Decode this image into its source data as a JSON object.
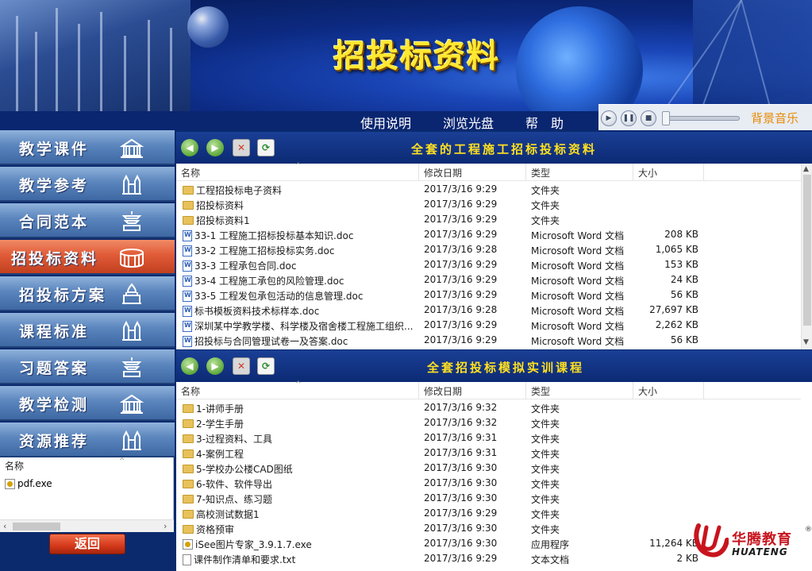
{
  "banner": {
    "title": "招投标资料"
  },
  "topnav": {
    "items": [
      {
        "label": "使用说明"
      },
      {
        "label": "浏览光盘"
      },
      {
        "label": "帮　助"
      }
    ]
  },
  "music": {
    "label": "背景音乐"
  },
  "sidebar": {
    "items": [
      {
        "label": "教学课件"
      },
      {
        "label": "教学参考"
      },
      {
        "label": "合同范本"
      },
      {
        "label": "招投标资料"
      },
      {
        "label": "招投标方案"
      },
      {
        "label": "课程标准"
      },
      {
        "label": "习题答案"
      },
      {
        "label": "教学检测"
      },
      {
        "label": "资源推荐"
      }
    ],
    "active_index": 3
  },
  "left_pane": {
    "header": "名称",
    "files": [
      {
        "name": "pdf.exe"
      }
    ]
  },
  "back_button": {
    "label": "返回"
  },
  "columns": {
    "name": "名称",
    "date": "修改日期",
    "type": "类型",
    "size": "大小"
  },
  "pane1": {
    "title": "全套的工程施工招标投标资料",
    "rows": [
      {
        "icon": "folder",
        "name": "工程招投标电子资料",
        "date": "2017/3/16 9:29",
        "type": "文件夹",
        "size": ""
      },
      {
        "icon": "folder",
        "name": "招投标资料",
        "date": "2017/3/16 9:29",
        "type": "文件夹",
        "size": ""
      },
      {
        "icon": "folder",
        "name": "招投标资料1",
        "date": "2017/3/16 9:29",
        "type": "文件夹",
        "size": ""
      },
      {
        "icon": "doc",
        "name": "33-1 工程施工招标投标基本知识.doc",
        "date": "2017/3/16 9:29",
        "type": "Microsoft Word 文档",
        "size": "208 KB"
      },
      {
        "icon": "doc",
        "name": "33-2 工程施工招标投标实务.doc",
        "date": "2017/3/16 9:28",
        "type": "Microsoft Word 文档",
        "size": "1,065 KB"
      },
      {
        "icon": "doc",
        "name": "33-3 工程承包合同.doc",
        "date": "2017/3/16 9:29",
        "type": "Microsoft Word 文档",
        "size": "153 KB"
      },
      {
        "icon": "doc",
        "name": "33-4 工程施工承包的风险管理.doc",
        "date": "2017/3/16 9:29",
        "type": "Microsoft Word 文档",
        "size": "24 KB"
      },
      {
        "icon": "doc",
        "name": "33-5 工程发包承包活动的信息管理.doc",
        "date": "2017/3/16 9:29",
        "type": "Microsoft Word 文档",
        "size": "56 KB"
      },
      {
        "icon": "doc",
        "name": "标书模板资料技术标样本.doc",
        "date": "2017/3/16 9:28",
        "type": "Microsoft Word 文档",
        "size": "27,697 KB"
      },
      {
        "icon": "doc",
        "name": "深圳某中学教学楼、科学楼及宿舍楼工程施工组织...",
        "date": "2017/3/16 9:29",
        "type": "Microsoft Word 文档",
        "size": "2,262 KB"
      },
      {
        "icon": "doc",
        "name": "招投标与合同管理试卷一及答案.doc",
        "date": "2017/3/16 9:29",
        "type": "Microsoft Word 文档",
        "size": "56 KB"
      }
    ]
  },
  "pane2": {
    "title": "全套招投标模拟实训课程",
    "rows": [
      {
        "icon": "folder",
        "name": "1-讲师手册",
        "date": "2017/3/16 9:32",
        "type": "文件夹",
        "size": ""
      },
      {
        "icon": "folder",
        "name": "2-学生手册",
        "date": "2017/3/16 9:32",
        "type": "文件夹",
        "size": ""
      },
      {
        "icon": "folder",
        "name": "3-过程资料、工具",
        "date": "2017/3/16 9:31",
        "type": "文件夹",
        "size": ""
      },
      {
        "icon": "folder",
        "name": "4-案例工程",
        "date": "2017/3/16 9:31",
        "type": "文件夹",
        "size": ""
      },
      {
        "icon": "folder",
        "name": "5-学校办公楼CAD图纸",
        "date": "2017/3/16 9:30",
        "type": "文件夹",
        "size": ""
      },
      {
        "icon": "folder",
        "name": "6-软件、软件导出",
        "date": "2017/3/16 9:30",
        "type": "文件夹",
        "size": ""
      },
      {
        "icon": "folder",
        "name": "7-知识点、练习题",
        "date": "2017/3/16 9:30",
        "type": "文件夹",
        "size": ""
      },
      {
        "icon": "folder",
        "name": "高校测试数据1",
        "date": "2017/3/16 9:29",
        "type": "文件夹",
        "size": ""
      },
      {
        "icon": "folder",
        "name": "资格预审",
        "date": "2017/3/16 9:30",
        "type": "文件夹",
        "size": ""
      },
      {
        "icon": "exe",
        "name": "iSee图片专家_3.9.1.7.exe",
        "date": "2017/3/16 9:30",
        "type": "应用程序",
        "size": "11,264 KB"
      },
      {
        "icon": "txt",
        "name": "课件制作清单和要求.txt",
        "date": "2017/3/16 9:29",
        "type": "文本文档",
        "size": "2 KB"
      }
    ]
  },
  "logo": {
    "cn": "华腾教育",
    "en": "HUATENG",
    "reg": "®"
  },
  "colors": {
    "accent_yellow": "#ffe020",
    "active_tab": "#e15b38",
    "nav_blue": "#0a2670",
    "music_label": "#e88a00"
  }
}
